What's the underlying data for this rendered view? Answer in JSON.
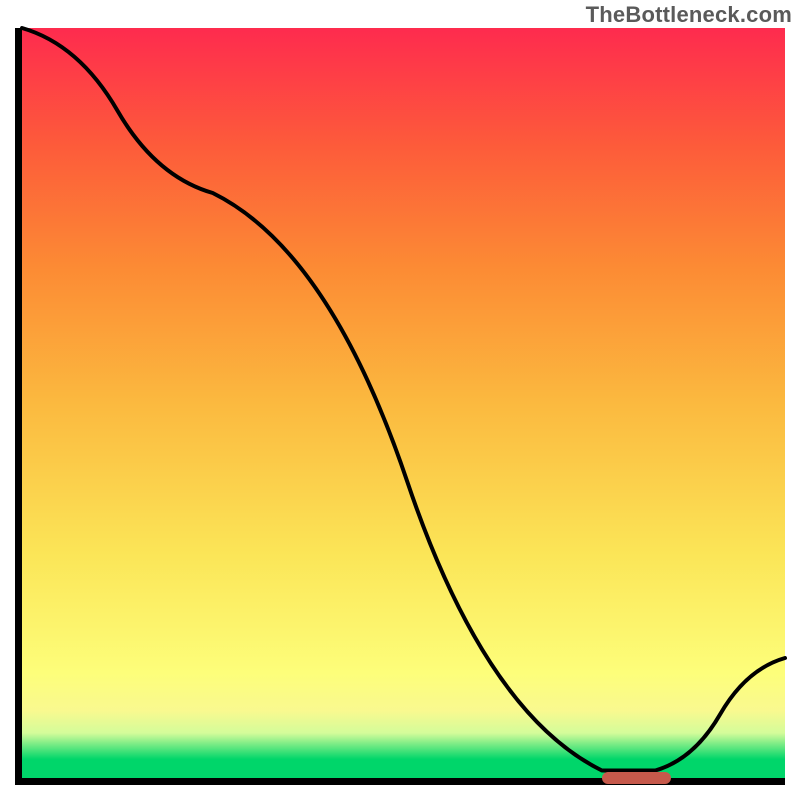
{
  "watermark": "TheBottleneck.com",
  "colors": {
    "gradient_top": "#fe2b4e",
    "gradient_bottom": "#00d66a",
    "curve": "#000000",
    "marker": "#c6594b",
    "axis": "#000000"
  },
  "chart_data": {
    "type": "line",
    "title": "",
    "xlabel": "",
    "ylabel": "",
    "xlim": [
      0,
      100
    ],
    "ylim": [
      0,
      100
    ],
    "grid": false,
    "series": [
      {
        "name": "bottleneck-curve",
        "x": [
          0,
          25,
          76,
          83,
          100
        ],
        "values": [
          100,
          78,
          1,
          1,
          16
        ]
      }
    ],
    "marker": {
      "x_start": 76,
      "x_end": 85,
      "y": 0.5
    },
    "annotations": []
  }
}
